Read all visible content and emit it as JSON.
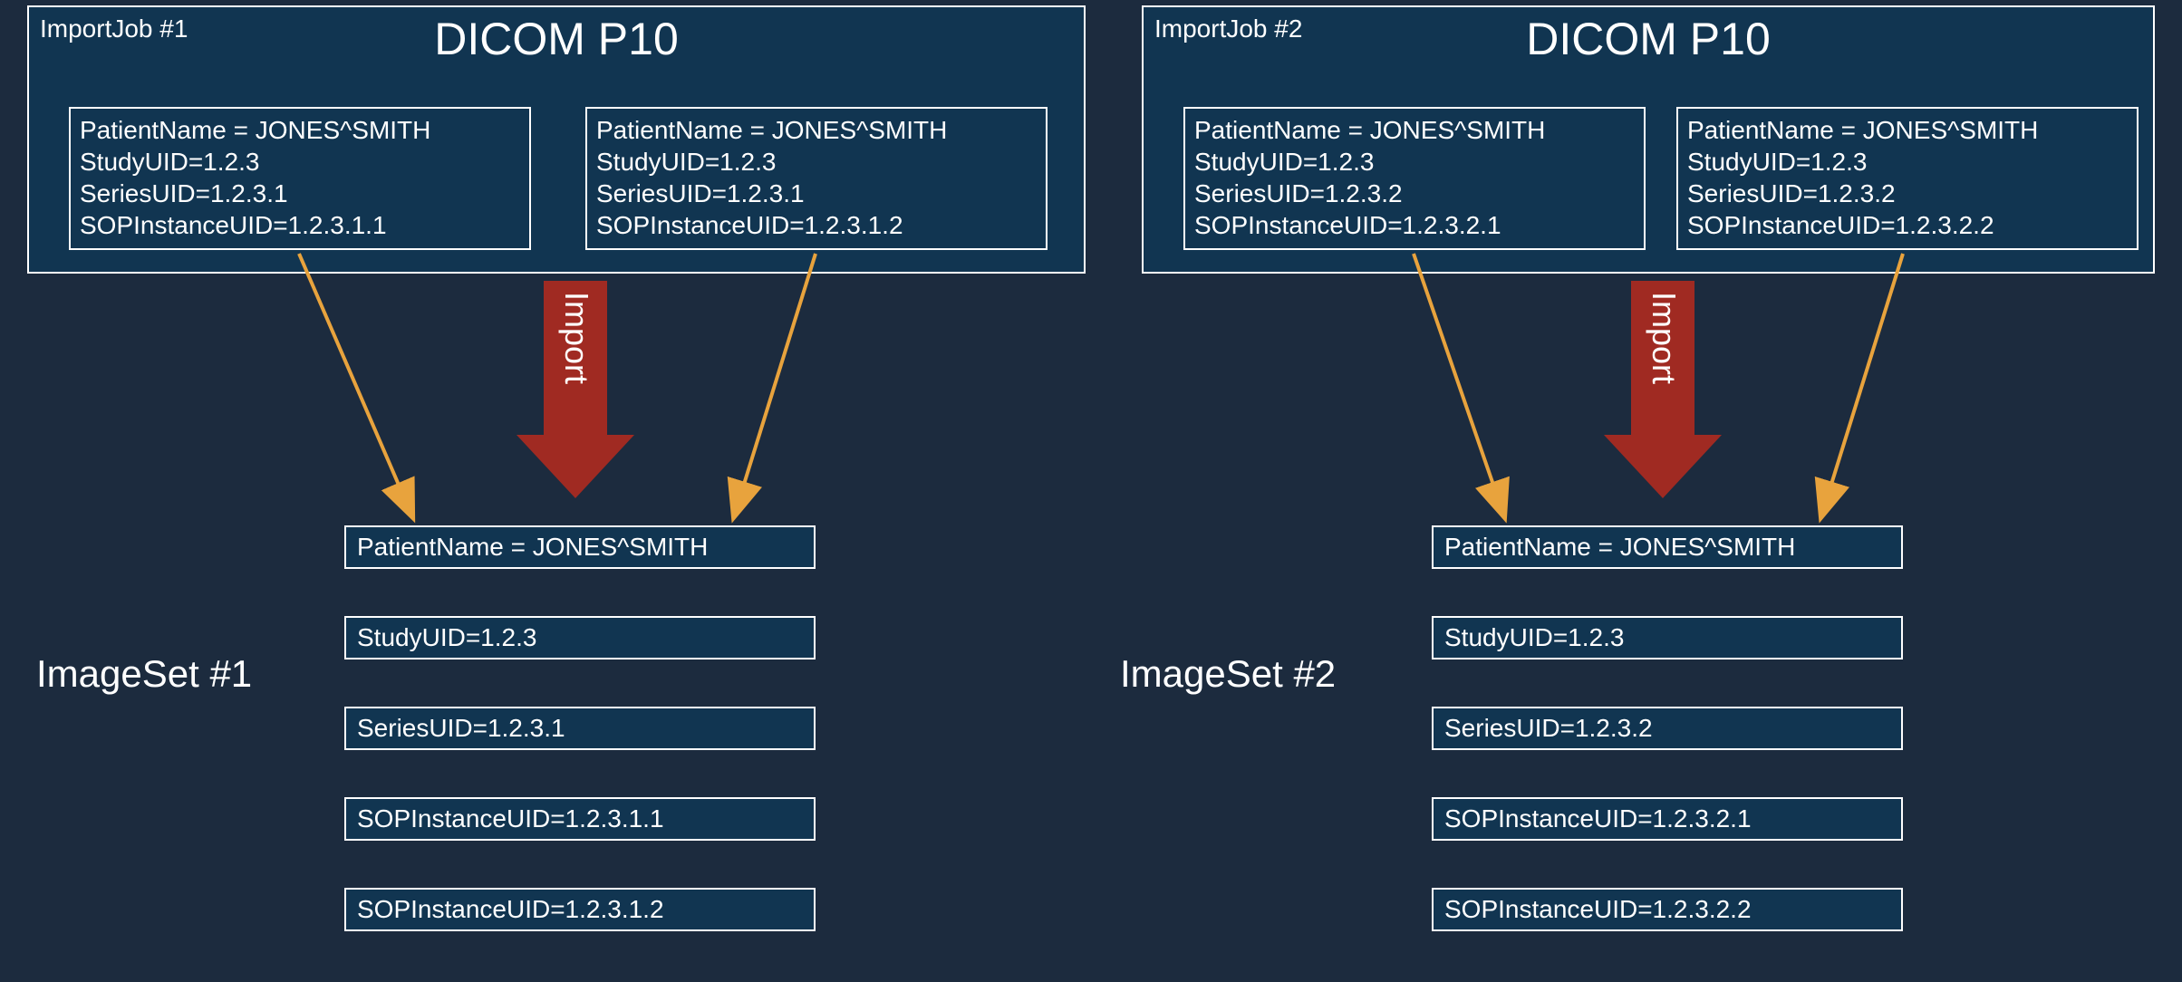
{
  "job1": {
    "label": "ImportJob #1",
    "title": "DICOM P10",
    "instanceA": {
      "patient": "PatientName = JONES^SMITH",
      "study": "StudyUID=1.2.3",
      "series": "SeriesUID=1.2.3.1",
      "sop": "SOPInstanceUID=1.2.3.1.1"
    },
    "instanceB": {
      "patient": "PatientName = JONES^SMITH",
      "study": "StudyUID=1.2.3",
      "series": "SeriesUID=1.2.3.1",
      "sop": "SOPInstanceUID=1.2.3.1.2"
    }
  },
  "job2": {
    "label": "ImportJob #2",
    "title": "DICOM P10",
    "instanceA": {
      "patient": "PatientName = JONES^SMITH",
      "study": "StudyUID=1.2.3",
      "series": "SeriesUID=1.2.3.2",
      "sop": "SOPInstanceUID=1.2.3.2.1"
    },
    "instanceB": {
      "patient": "PatientName = JONES^SMITH",
      "study": "StudyUID=1.2.3",
      "series": "SeriesUID=1.2.3.2",
      "sop": "SOPInstanceUID=1.2.3.2.2"
    }
  },
  "importLabel": "Import",
  "imageset1": {
    "label": "ImageSet #1",
    "rows": {
      "patient": "PatientName = JONES^SMITH",
      "study": "StudyUID=1.2.3",
      "series": "SeriesUID=1.2.3.1",
      "sop1": "SOPInstanceUID=1.2.3.1.1",
      "sop2": "SOPInstanceUID=1.2.3.1.2"
    }
  },
  "imageset2": {
    "label": "ImageSet #2",
    "rows": {
      "patient": "PatientName = JONES^SMITH",
      "study": "StudyUID=1.2.3",
      "series": "SeriesUID=1.2.3.2",
      "sop1": "SOPInstanceUID=1.2.3.2.1",
      "sop2": "SOPInstanceUID=1.2.3.2.2"
    }
  }
}
